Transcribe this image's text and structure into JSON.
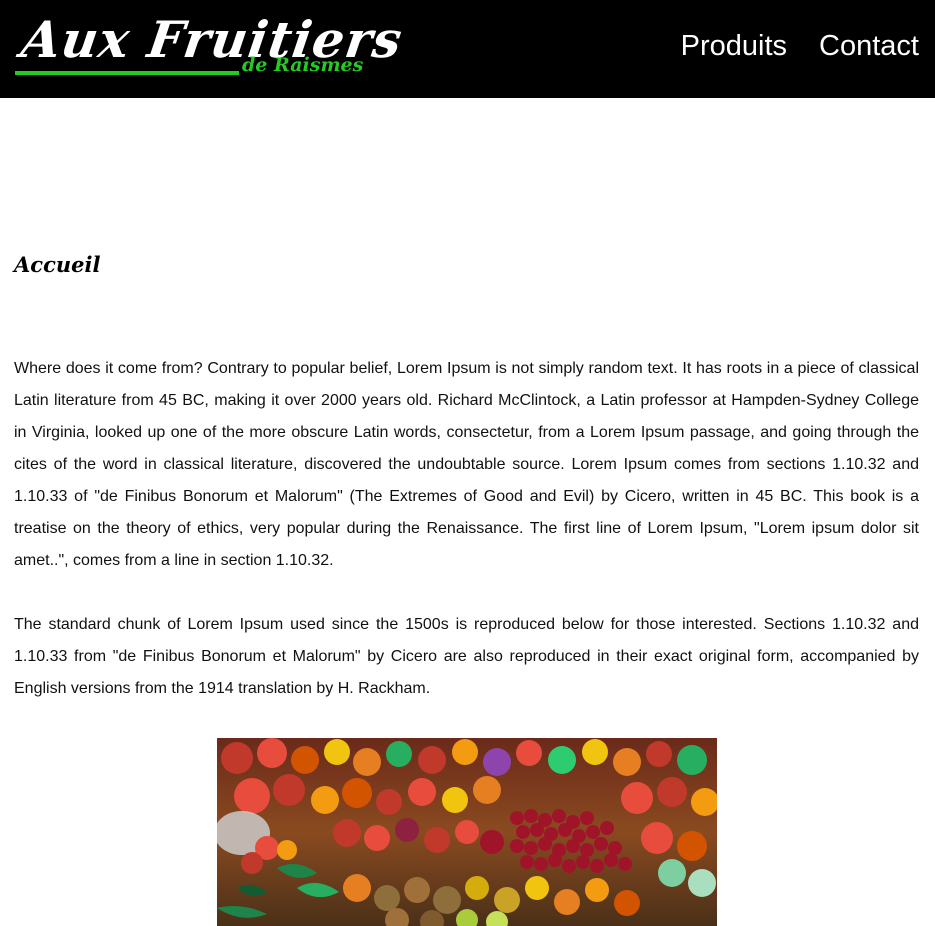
{
  "header": {
    "logo": {
      "main_text": "Aux Fruitiers",
      "sub_text": "de Raismes",
      "accent_color": "#22cc22"
    },
    "nav": [
      {
        "label": "Produits"
      },
      {
        "label": "Contact"
      }
    ],
    "background_color": "#000000"
  },
  "main": {
    "title": "Accueil",
    "paragraphs": [
      "Where does it come from? Contrary to popular belief, Lorem Ipsum is not simply random text. It has roots in a piece of classical Latin literature from 45 BC, making it over 2000 years old. Richard McClintock, a Latin professor at Hampden-Sydney College in Virginia, looked up one of the more obscure Latin words, consectetur, from a Lorem Ipsum passage, and going through the cites of the word in classical literature, discovered the undoubtable source. Lorem Ipsum comes from sections 1.10.32 and 1.10.33 of \"de Finibus Bonorum et Malorum\" (The Extremes of Good and Evil) by Cicero, written in 45 BC. This book is a treatise on the theory of ethics, very popular during the Renaissance. The first line of Lorem Ipsum, \"Lorem ipsum dolor sit amet..\", comes from a line in section 1.10.32.",
      "The standard chunk of Lorem Ipsum used since the 1500s is reproduced below for those interested. Sections 1.10.32 and 1.10.33 from \"de Finibus Bonorum et Malorum\" by Cicero are also reproduced in their exact original form, accompanied by English versions from the 1914 translation by H. Rackham."
    ],
    "image": {
      "subject": "fruit-market-stall-photo"
    }
  }
}
